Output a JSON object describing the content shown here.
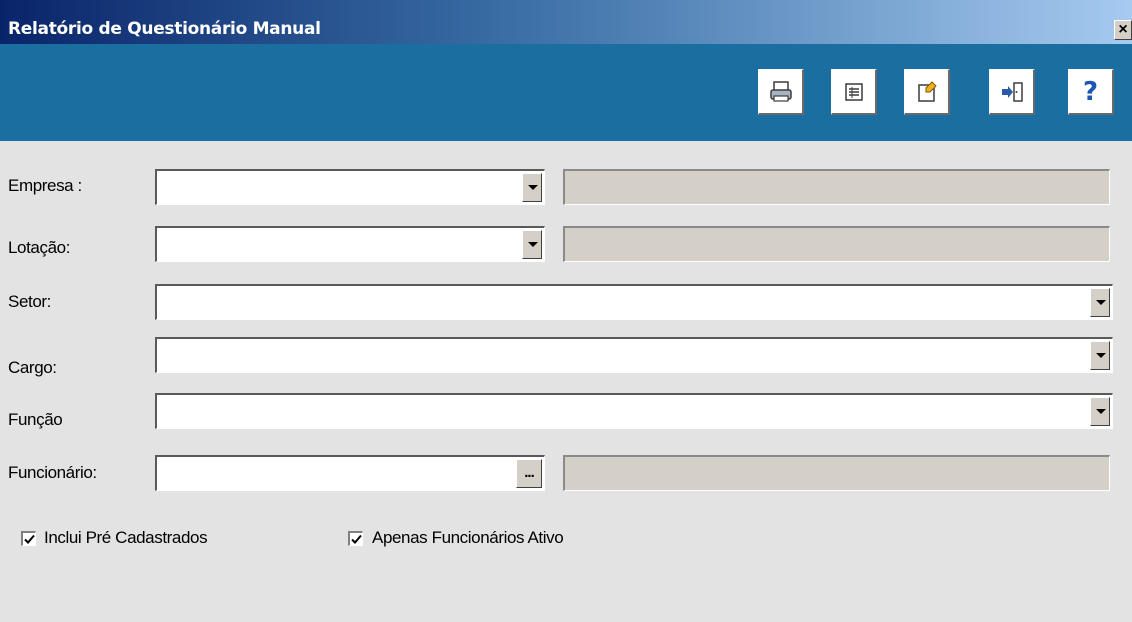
{
  "window": {
    "title": "Relatório de Questionário Manual",
    "close_glyph": "×",
    "colors": {
      "title_start": "#0a246a",
      "title_end": "#a6caf0",
      "toolbar": "#1b6fa0",
      "body": "#e3e3e3"
    }
  },
  "toolbar": {
    "buttons": [
      {
        "name": "print-button",
        "icon": "printer-icon"
      },
      {
        "name": "preview-button",
        "icon": "table-list-icon"
      },
      {
        "name": "edit-report-button",
        "icon": "edit-document-icon"
      },
      {
        "name": "exit-button",
        "icon": "exit-door-icon"
      },
      {
        "name": "help-button",
        "icon": "help-icon",
        "glyph": "?"
      }
    ]
  },
  "form": {
    "empresa": {
      "label": "Empresa :",
      "value": "",
      "description": ""
    },
    "lotacao": {
      "label": "Lotação:",
      "value": "",
      "description": ""
    },
    "setor": {
      "label": "Setor:",
      "value": ""
    },
    "cargo": {
      "label": "Cargo:",
      "value": ""
    },
    "funcao": {
      "label": "Função",
      "value": ""
    },
    "funcionario": {
      "label": "Funcionário:",
      "value": "",
      "lookup_label": "...",
      "description": ""
    }
  },
  "options": {
    "inclui_pre": {
      "label": "Inclui Pré Cadastrados",
      "checked": true
    },
    "apenas_ativos": {
      "label": "Apenas Funcionários Ativo",
      "checked": true
    }
  }
}
